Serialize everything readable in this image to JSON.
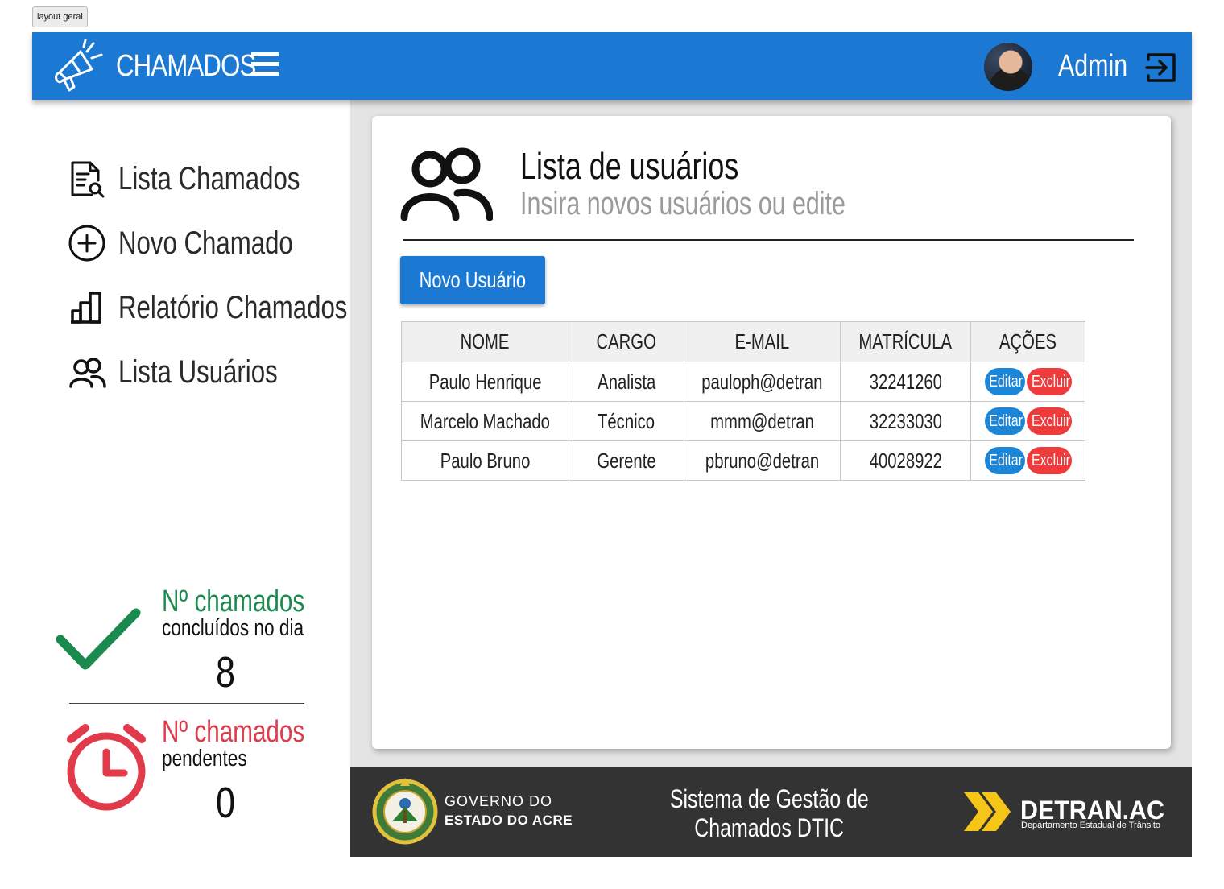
{
  "frame_label": "layout geral",
  "header": {
    "brand": "CHAMADOS",
    "user_name": "Admin"
  },
  "sidebar": {
    "items": [
      {
        "label": "Lista Chamados",
        "icon": "document-search-icon"
      },
      {
        "label": "Novo Chamado",
        "icon": "plus-circle-icon"
      },
      {
        "label": "Relatório Chamados",
        "icon": "bar-chart-icon"
      },
      {
        "label": "Lista Usuários",
        "icon": "users-icon"
      }
    ]
  },
  "stats": {
    "done": {
      "title": "Nº chamados",
      "subtitle": "concluídos no dia",
      "value": "8",
      "color": "#1b8a4e"
    },
    "pending": {
      "title": "Nº chamados",
      "subtitle": "pendentes",
      "value": "0",
      "color": "#e03a4b"
    }
  },
  "main": {
    "title": "Lista de usuários",
    "subtitle": "Insira novos usuários ou edite",
    "new_user_button": "Novo Usuário",
    "table": {
      "headers": [
        "NOME",
        "CARGO",
        "E-MAIL",
        "MATRÍCULA",
        "AÇÕES"
      ],
      "edit_label": "Editar",
      "delete_label": "Excluir",
      "rows": [
        {
          "name": "Paulo Henrique",
          "role": "Analista",
          "email": "pauloph@detran",
          "id": "32241260"
        },
        {
          "name": "Marcelo Machado",
          "role": "Técnico",
          "email": "mmm@detran",
          "id": "32233030"
        },
        {
          "name": "Paulo Bruno",
          "role": "Gerente",
          "email": "pbruno@detran",
          "id": "40028922"
        }
      ]
    }
  },
  "footer": {
    "gov_line1": "GOVERNO DO",
    "gov_line2": "ESTADO DO ACRE",
    "system_line1": "Sistema de Gestão de",
    "system_line2": "Chamados DTIC",
    "detran_name": "DETRAN.AC",
    "detran_sub": "Departamento Estadual de Trânsito"
  },
  "colors": {
    "primary": "#1b79d4",
    "success": "#1b8a4e",
    "danger": "#e03a4b",
    "footer_bg": "#333333",
    "detran_yellow": "#f5c518"
  }
}
